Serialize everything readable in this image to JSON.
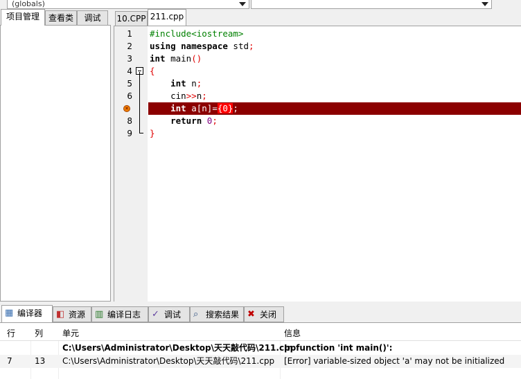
{
  "toolbar": {
    "scope_combo": "(globals)",
    "member_combo": ""
  },
  "left_tabs": [
    {
      "label": "项目管理",
      "active": true
    },
    {
      "label": "查看类"
    },
    {
      "label": "调试"
    }
  ],
  "editor_tabs": [
    {
      "label": "10.CPP"
    },
    {
      "label": "211.cpp",
      "active": true
    }
  ],
  "editor": {
    "lines": [
      {
        "n": "1",
        "html": "<span class='pp'>#include&lt;iostream&gt;</span>"
      },
      {
        "n": "2",
        "html": "<span class='kw'>using namespace</span> std<span class='sym'>;</span>"
      },
      {
        "n": "3",
        "html": "<span class='kw'>int</span> main<span class='sym'>()</span>"
      },
      {
        "n": "4",
        "html": "<span class='sym'>{</span>",
        "fold": true
      },
      {
        "n": "5",
        "html": "    <span class='kw'>int</span> n<span class='sym'>;</span>"
      },
      {
        "n": "6",
        "html": "    cin<span class='sym'>&gt;&gt;</span>n<span class='sym'>;</span>"
      },
      {
        "n": "7",
        "html": "    <span class='kw'>int</span> a[n]=<span class='hl'>{0}</span>;",
        "error": true
      },
      {
        "n": "8",
        "html": "    <span class='kw'>return</span> <span class='num'>0</span><span class='sym'>;</span>"
      },
      {
        "n": "9",
        "html": "<span class='sym'>}</span>"
      }
    ],
    "error_line_color": "#8b0000"
  },
  "bottom_tabs": [
    {
      "label": "编译器",
      "icon": "compiler-icon",
      "active": true
    },
    {
      "label": "资源",
      "icon": "resources-icon"
    },
    {
      "label": "编译日志",
      "icon": "compile-log-icon"
    },
    {
      "label": "调试",
      "icon": "debug-check-icon"
    },
    {
      "label": "搜索结果",
      "icon": "search-results-icon"
    },
    {
      "label": "关闭",
      "icon": "close-icon"
    }
  ],
  "messages": {
    "headers": {
      "line": "行",
      "col": "列",
      "unit": "单元",
      "info": "信息"
    },
    "rows": [
      {
        "line": "",
        "col": "",
        "unit": "C:\\Users\\Administrator\\Desktop\\天天敲代码\\211.cpp",
        "info": "In function 'int main()':",
        "bold": true
      },
      {
        "line": "7",
        "col": "13",
        "unit": "C:\\Users\\Administrator\\Desktop\\天天敲代码\\211.cpp",
        "info": "[Error] variable-sized object 'a' may not be initialized"
      }
    ]
  }
}
